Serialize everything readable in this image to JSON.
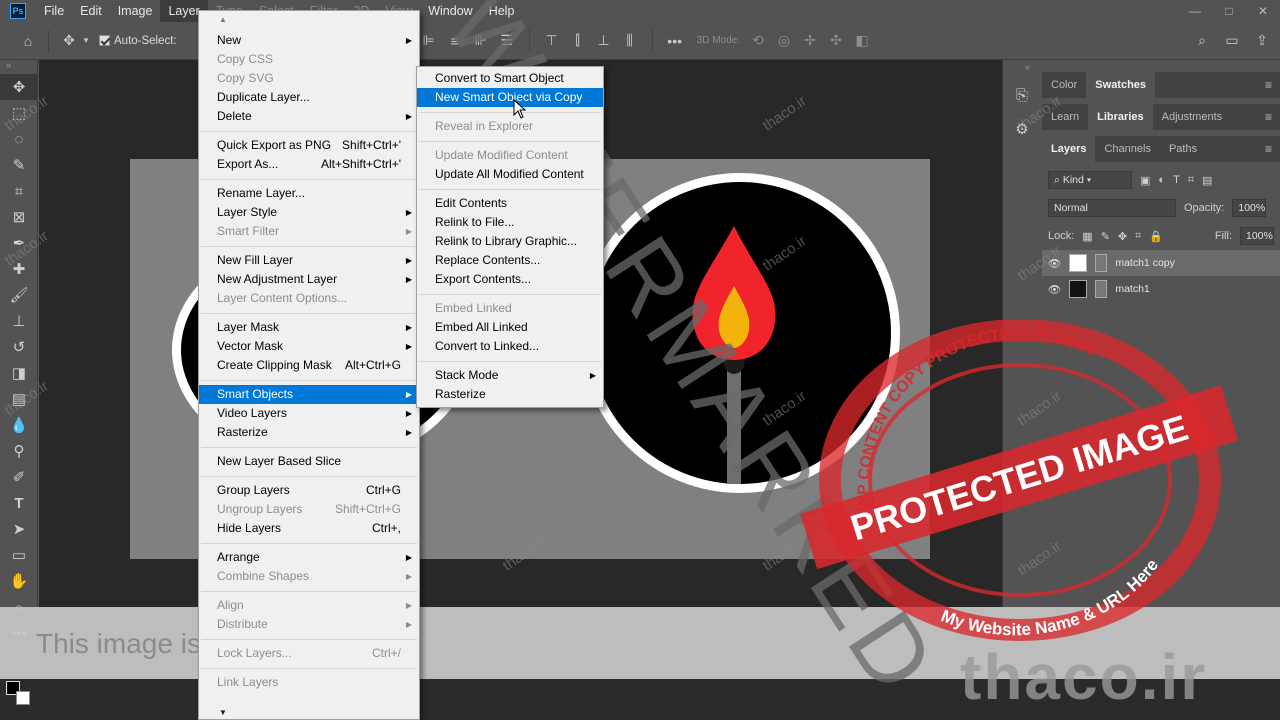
{
  "app": {
    "logo": "Ps"
  },
  "menubar": {
    "items": [
      "File",
      "Edit",
      "Image",
      "Layer",
      "Type",
      "Select",
      "Filter",
      "3D",
      "View",
      "Window",
      "Help"
    ]
  },
  "window_controls": {
    "minimize": "—",
    "maximize": "□",
    "close": "✕"
  },
  "options_bar": {
    "auto_select_label": "Auto-Select:",
    "mode_label": "3D Mode:"
  },
  "layer_menu": {
    "items": [
      {
        "label": "New",
        "shortcut": "",
        "submenu": true,
        "disabled": false
      },
      {
        "label": "Copy CSS",
        "shortcut": "",
        "submenu": false,
        "disabled": true
      },
      {
        "label": "Copy SVG",
        "shortcut": "",
        "submenu": false,
        "disabled": true
      },
      {
        "label": "Duplicate Layer...",
        "shortcut": "",
        "submenu": false,
        "disabled": false
      },
      {
        "label": "Delete",
        "shortcut": "",
        "submenu": true,
        "disabled": false
      },
      {
        "sep": true
      },
      {
        "label": "Quick Export as PNG",
        "shortcut": "Shift+Ctrl+'",
        "submenu": false,
        "disabled": false
      },
      {
        "label": "Export As...",
        "shortcut": "Alt+Shift+Ctrl+'",
        "submenu": false,
        "disabled": false
      },
      {
        "sep": true
      },
      {
        "label": "Rename Layer...",
        "shortcut": "",
        "submenu": false,
        "disabled": false
      },
      {
        "label": "Layer Style",
        "shortcut": "",
        "submenu": true,
        "disabled": false
      },
      {
        "label": "Smart Filter",
        "shortcut": "",
        "submenu": true,
        "disabled": true
      },
      {
        "sep": true
      },
      {
        "label": "New Fill Layer",
        "shortcut": "",
        "submenu": true,
        "disabled": false
      },
      {
        "label": "New Adjustment Layer",
        "shortcut": "",
        "submenu": true,
        "disabled": false
      },
      {
        "label": "Layer Content Options...",
        "shortcut": "",
        "submenu": false,
        "disabled": true
      },
      {
        "sep": true
      },
      {
        "label": "Layer Mask",
        "shortcut": "",
        "submenu": true,
        "disabled": false
      },
      {
        "label": "Vector Mask",
        "shortcut": "",
        "submenu": true,
        "disabled": false
      },
      {
        "label": "Create Clipping Mask",
        "shortcut": "Alt+Ctrl+G",
        "submenu": false,
        "disabled": false
      },
      {
        "sep": true
      },
      {
        "label": "Smart Objects",
        "shortcut": "",
        "submenu": true,
        "disabled": false,
        "highlight": true
      },
      {
        "label": "Video Layers",
        "shortcut": "",
        "submenu": true,
        "disabled": false
      },
      {
        "label": "Rasterize",
        "shortcut": "",
        "submenu": true,
        "disabled": false
      },
      {
        "sep": true
      },
      {
        "label": "New Layer Based Slice",
        "shortcut": "",
        "submenu": false,
        "disabled": false
      },
      {
        "sep": true
      },
      {
        "label": "Group Layers",
        "shortcut": "Ctrl+G",
        "submenu": false,
        "disabled": false
      },
      {
        "label": "Ungroup Layers",
        "shortcut": "Shift+Ctrl+G",
        "submenu": false,
        "disabled": true
      },
      {
        "label": "Hide Layers",
        "shortcut": "Ctrl+,",
        "submenu": false,
        "disabled": false
      },
      {
        "sep": true
      },
      {
        "label": "Arrange",
        "shortcut": "",
        "submenu": true,
        "disabled": false
      },
      {
        "label": "Combine Shapes",
        "shortcut": "",
        "submenu": true,
        "disabled": true
      },
      {
        "sep": true
      },
      {
        "label": "Align",
        "shortcut": "",
        "submenu": true,
        "disabled": true
      },
      {
        "label": "Distribute",
        "shortcut": "",
        "submenu": true,
        "disabled": true
      },
      {
        "sep": true
      },
      {
        "label": "Lock Layers...",
        "shortcut": "Ctrl+/",
        "submenu": false,
        "disabled": true
      },
      {
        "sep": true
      },
      {
        "label": "Link Layers",
        "shortcut": "",
        "submenu": false,
        "disabled": true
      }
    ]
  },
  "smart_objects_menu": {
    "items": [
      {
        "label": "Convert to Smart Object",
        "disabled": false
      },
      {
        "label": "New Smart Object via Copy",
        "disabled": false,
        "highlight": true
      },
      {
        "sep": true
      },
      {
        "label": "Reveal in Explorer",
        "disabled": true
      },
      {
        "sep": true
      },
      {
        "label": "Update Modified Content",
        "disabled": true
      },
      {
        "label": "Update All Modified Content",
        "disabled": false
      },
      {
        "sep": true
      },
      {
        "label": "Edit Contents",
        "disabled": false
      },
      {
        "label": "Relink to File...",
        "disabled": false
      },
      {
        "label": "Relink to Library Graphic...",
        "disabled": false
      },
      {
        "label": "Replace Contents...",
        "disabled": false
      },
      {
        "label": "Export Contents...",
        "disabled": false
      },
      {
        "sep": true
      },
      {
        "label": "Embed Linked",
        "disabled": true
      },
      {
        "label": "Embed All Linked",
        "disabled": false
      },
      {
        "label": "Convert to Linked...",
        "disabled": false
      },
      {
        "sep": true
      },
      {
        "label": "Stack Mode",
        "disabled": false,
        "submenu": true
      },
      {
        "label": "Rasterize",
        "disabled": false
      }
    ]
  },
  "panels": {
    "top_tabs": [
      "Color",
      "Swatches"
    ],
    "mid_tabs": [
      "Learn",
      "Libraries",
      "Adjustments"
    ],
    "layers_tabs": [
      "Layers",
      "Channels",
      "Paths"
    ],
    "kind_label": "Kind",
    "blend_mode": "Normal",
    "opacity_label": "Opacity:",
    "opacity_value": "100%",
    "lock_label": "Lock:",
    "fill_label": "Fill:",
    "fill_value": "100%",
    "layers": [
      {
        "name": "match1 copy",
        "selected": true
      },
      {
        "name": "match1",
        "selected": false
      }
    ]
  },
  "overlay": {
    "protected_text": "This image is protected",
    "big_watermark": "WATERMARKED",
    "small_watermark": "thaco.ir",
    "stamp_main": "PROTECTED IMAGE",
    "stamp_ring": "WP CONTENT COPY PROTECTION PLUGIN",
    "stamp_sub": "My Website Name & URL Here",
    "brand": "thaco.ir"
  },
  "colors": {
    "menu_highlight": "#0078d7",
    "stamp_red": "#d8282c",
    "flame_red": "#f0242a",
    "flame_yellow": "#f4b20c"
  }
}
